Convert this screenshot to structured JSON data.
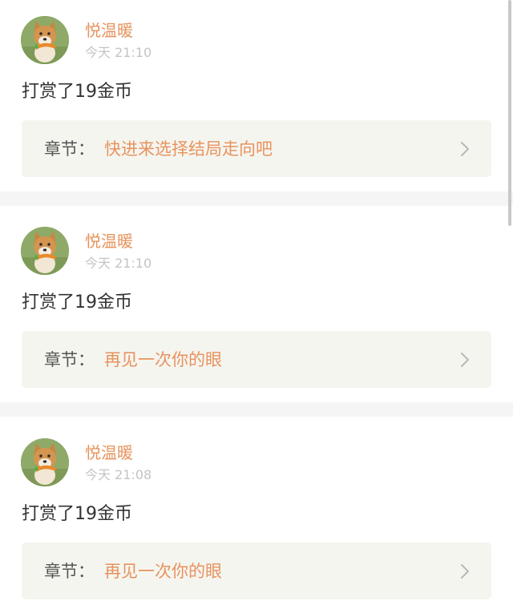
{
  "feed": {
    "items": [
      {
        "user_name": "悦温暖",
        "timestamp": "今天 21:10",
        "action": "打赏了19金币",
        "chapter_prefix": "章节：",
        "chapter_title": "快进来选择结局走向吧"
      },
      {
        "user_name": "悦温暖",
        "timestamp": "今天 21:10",
        "action": "打赏了19金币",
        "chapter_prefix": "章节：",
        "chapter_title": "再见一次你的眼"
      },
      {
        "user_name": "悦温暖",
        "timestamp": "今天 21:08",
        "action": "打赏了19金币",
        "chapter_prefix": "章节：",
        "chapter_title": "再见一次你的眼"
      }
    ]
  },
  "colors": {
    "accent": "#e7935d",
    "chapter_box_bg": "#f5f5f0",
    "separator": "#f5f5f5",
    "timestamp": "#c4c4c4",
    "body_text": "#333333"
  },
  "icons": {
    "avatar": "shiba-dog-avatar-icon",
    "chevron": "chevron-right-icon"
  }
}
